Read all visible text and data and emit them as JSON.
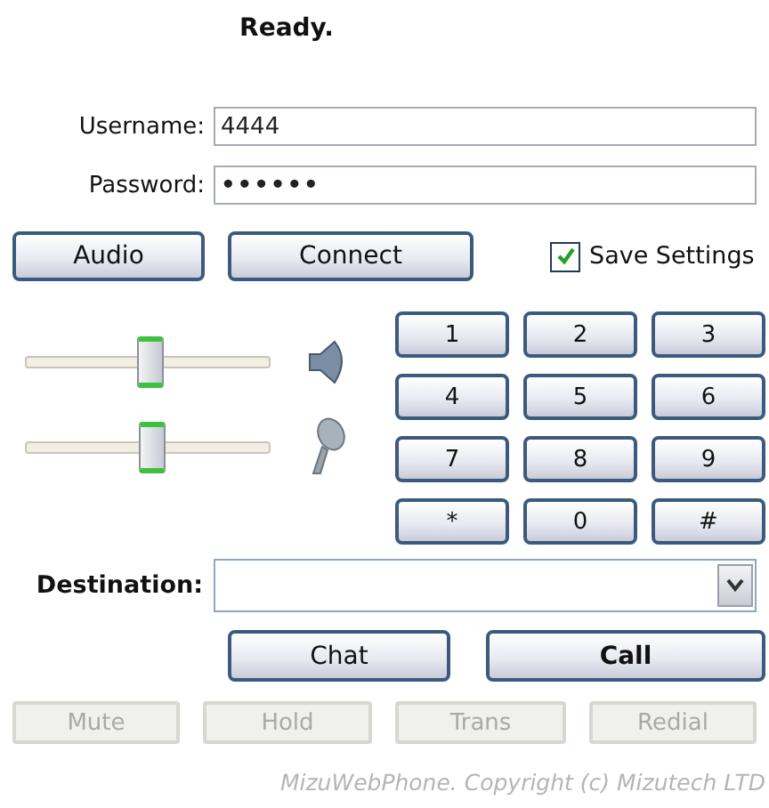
{
  "status": "Ready.",
  "username": {
    "label": "Username:",
    "value": "4444"
  },
  "password": {
    "label": "Password:",
    "value": "••••••"
  },
  "buttons": [
    {
      "label": "Audio"
    },
    {
      "label": "Connect"
    }
  ],
  "save_settings": {
    "label": "Save Settings",
    "checked": true
  },
  "sliders": [
    {
      "kind": "speaker",
      "level": 0.52
    },
    {
      "kind": "microphone",
      "level": 0.53
    }
  ],
  "keypad": [
    "1",
    "2",
    "3",
    "4",
    "5",
    "6",
    "7",
    "8",
    "9",
    "*",
    "0",
    "#"
  ],
  "destination": {
    "label": "Destination:"
  },
  "call_buttons": [
    {
      "label": "Chat",
      "bold": false
    },
    {
      "label": "Call",
      "bold": true
    }
  ],
  "call_controls": [
    {
      "label": "Mute",
      "disabled": true
    },
    {
      "label": "Hold",
      "disabled": true
    },
    {
      "label": "Trans",
      "disabled": true
    },
    {
      "label": "Redial",
      "disabled": true
    }
  ],
  "copyright": "MizuWebPhone. Copyright (c) Mizutech LTD"
}
